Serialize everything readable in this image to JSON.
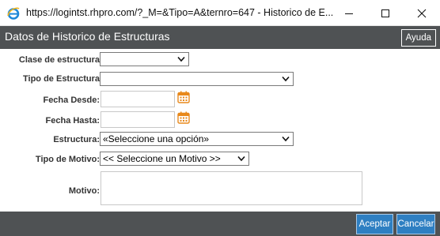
{
  "window": {
    "title": "https://logintst.rhpro.com/?_M=&Tipo=A&ternro=647 - Historico de E..."
  },
  "dialog": {
    "title": "Datos de Historico de Estructuras",
    "help_label": "Ayuda"
  },
  "form": {
    "clase_label": "Clase de estructura",
    "clase_value": "",
    "tipo_label": "Tipo de Estructura",
    "tipo_value": "",
    "desde_label": "Fecha Desde:",
    "desde_value": "",
    "hasta_label": "Fecha Hasta:",
    "hasta_value": "",
    "estructura_label": "Estructura:",
    "estructura_value": "«Seleccione una opción»",
    "motivo_tipo_label": "Tipo de Motivo:",
    "motivo_tipo_value": "<< Seleccione un Motivo >>",
    "motivo_label": "Motivo:",
    "motivo_value": ""
  },
  "footer": {
    "accept_label": "Aceptar",
    "cancel_label": "Cancelar"
  },
  "colors": {
    "header_bg": "#4f5254",
    "button_bg": "#2e7fc2",
    "calendar_icon": "#e8891c"
  },
  "icons": {
    "browser": "ie-icon",
    "calendar": "calendar-icon",
    "dropdown": "chevron-down-icon"
  }
}
